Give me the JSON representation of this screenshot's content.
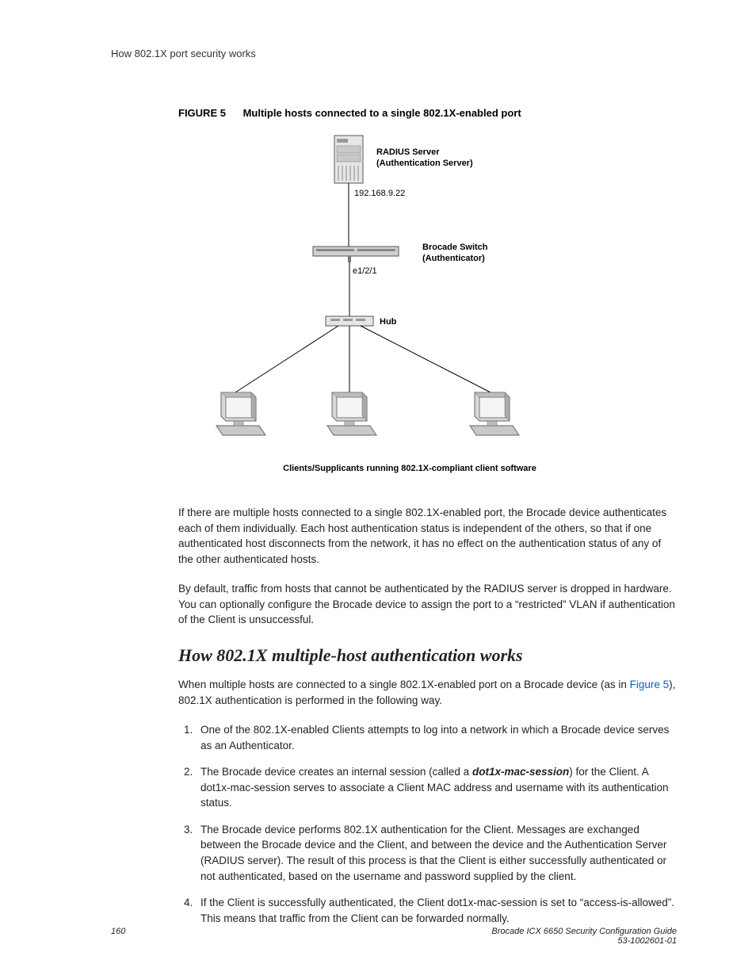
{
  "header": {
    "running_head": "How 802.1X port security works"
  },
  "figure": {
    "label": "FIGURE 5",
    "title": "Multiple hosts connected to a single 802.1X-enabled port",
    "radius_label_1": "RADIUS Server",
    "radius_label_2": "(Authentication Server)",
    "radius_ip": "192.168.9.22",
    "switch_label_1": "Brocade Switch",
    "switch_label_2": "(Authenticator)",
    "port_label": "e1/2/1",
    "hub_label": "Hub",
    "clients_caption": "Clients/Supplicants running 802.1X-compliant client software"
  },
  "paragraphs": {
    "p1": "If there are multiple hosts connected to a single 802.1X-enabled port, the Brocade device authenticates each of them individually. Each host authentication status is independent of the others, so that if one authenticated host disconnects from the network, it has no effect on the authentication status of any of the other authenticated hosts.",
    "p2": "By default, traffic from hosts that cannot be authenticated by the RADIUS server is dropped in hardware. You can optionally configure the Brocade device to assign the port to a “restricted” VLAN if authentication of the Client is unsuccessful."
  },
  "heading2": "How 802.1X multiple-host authentication works",
  "para_after_h2_a": "When multiple hosts are connected to a single 802.1X-enabled port on a Brocade device (as in ",
  "para_after_h2_link": "Figure 5",
  "para_after_h2_b": "), 802.1X authentication is performed in the following way.",
  "steps": {
    "s1": "One of the 802.1X-enabled Clients attempts to log into a network in which a Brocade device serves as an Authenticator.",
    "s2a": "The Brocade device creates an internal session (called a ",
    "s2b": "dot1x-mac-session",
    "s2c": ") for the Client. A dot1x-mac-session serves to associate a Client MAC address and username with its authentication status.",
    "s3": "The Brocade device performs 802.1X authentication for the Client. Messages are exchanged between the Brocade device and the Client, and between the device and the Authentication Server (RADIUS server). The result of this process is that the Client is either successfully authenticated or not authenticated, based on the username and password supplied by the client.",
    "s4": "If the Client is successfully authenticated, the Client dot1x-mac-session is set to “access-is-allowed”. This means that traffic from the Client can be forwarded normally."
  },
  "footer": {
    "page": "160",
    "doc1": "Brocade ICX 6650 Security Configuration Guide",
    "doc2": "53-1002601-01"
  }
}
